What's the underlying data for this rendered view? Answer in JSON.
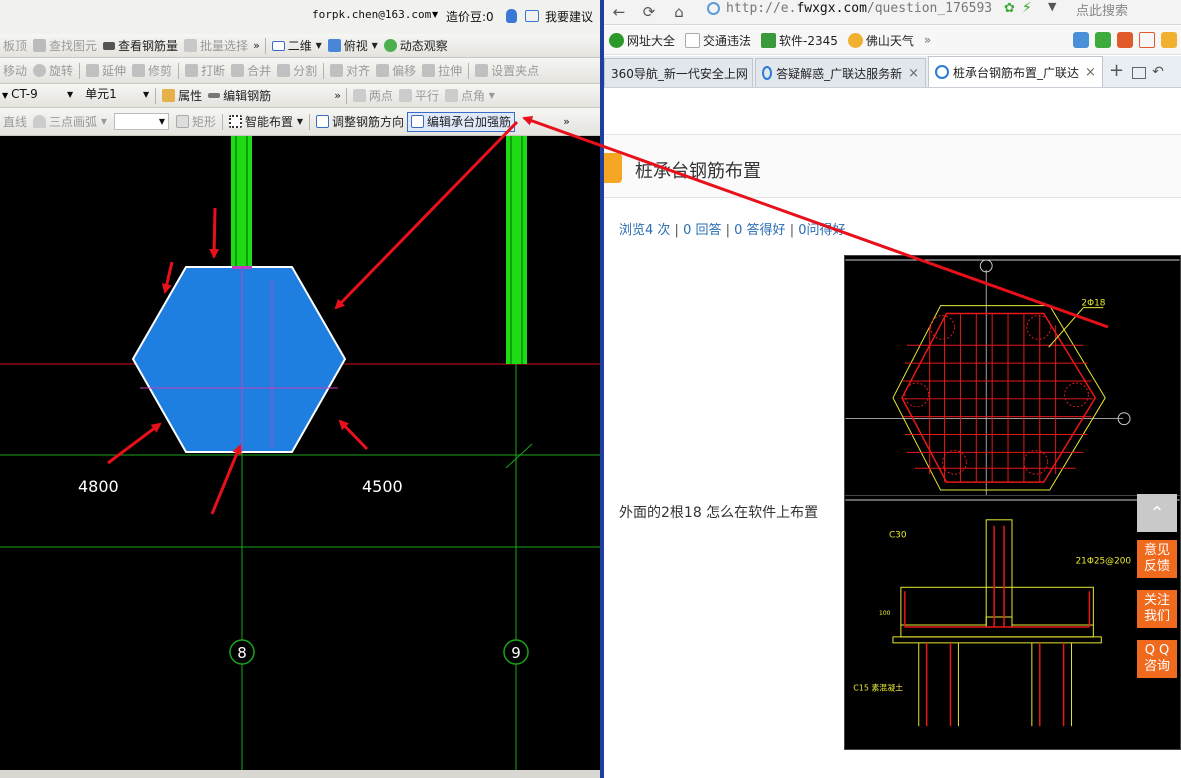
{
  "cad": {
    "login_email": "forpk.chen@163.com",
    "cost_label": "造价豆:0",
    "suggest_label": "我要建议",
    "row2": [
      "板顶",
      "查找图元",
      "查看钢筋量",
      "批量选择",
      "二维",
      "俯视",
      "动态观察"
    ],
    "row3": [
      "移动",
      "旋转",
      "延伸",
      "修剪",
      "打断",
      "合并",
      "分割",
      "对齐",
      "偏移",
      "拉伸",
      "设置夹点"
    ],
    "row4": {
      "component_select": "CT-9",
      "unit_select": "单元1",
      "attr_label": "属性",
      "edit_rebar_label": "编辑钢筋",
      "snap": [
        "两点",
        "平行",
        "点角"
      ]
    },
    "row5": {
      "line_label": "直线",
      "arc_label": "三点画弧",
      "rect_label": "矩形",
      "smart_label": "智能布置",
      "adjust_label": "调整钢筋方向",
      "edit_cap_label": "编辑承台加强筋"
    },
    "canvas": {
      "dim_left": "4800",
      "dim_right": "4500",
      "axis_left": "8",
      "axis_right": "9",
      "colors": {
        "hexagon": "#1e7fe0",
        "column": "#1ddc16",
        "axis_line": "#1aa31a",
        "red_line": "#d4101a",
        "arrow": "#e8101a"
      }
    }
  },
  "browser": {
    "url_prefix": "http://e.",
    "url_domain": "fwxgx.com",
    "url_rest": "/question_176593",
    "search_placeholder": "点此搜索",
    "bookmarks": [
      "网址大全",
      "交通违法",
      "软件-2345",
      "佛山天气"
    ],
    "tabs": [
      {
        "label": "360导航_新一代安全上网",
        "active": false
      },
      {
        "label": "答疑解惑_广联达服务新",
        "active": false
      },
      {
        "label": "桩承台钢筋布置_广联达",
        "active": true
      }
    ],
    "question": {
      "title": "桩承台钢筋布置",
      "views": "浏览4 次",
      "answers": "0 回答",
      "good": "0 答得好",
      "useful": "0问得好",
      "text": "外面的2根18 怎么在软件上布置"
    },
    "drawing1": {
      "label": "2Φ18"
    },
    "drawing2": {
      "label_c30": "C30",
      "label_rebar": "21Φ25@200",
      "label_c15": "C15 素混凝土",
      "label_100": "100"
    },
    "side_buttons": [
      {
        "line1": "意见",
        "line2": "反馈"
      },
      {
        "line1": "关注",
        "line2": "我们"
      },
      {
        "line1": "Q Q",
        "line2": "咨询"
      }
    ]
  }
}
